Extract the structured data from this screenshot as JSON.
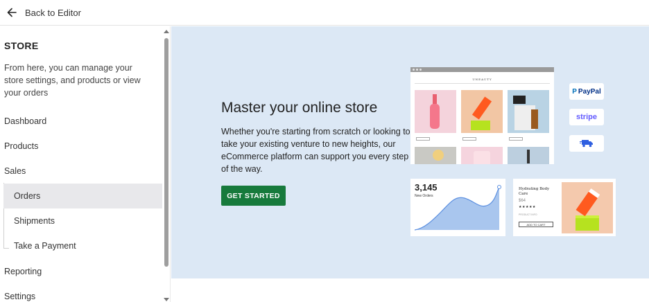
{
  "topbar": {
    "back_label": "Back to Editor"
  },
  "sidebar": {
    "title": "STORE",
    "description": "From here, you can manage your store settings, and products or view your orders",
    "items": {
      "dashboard": "Dashboard",
      "products": "Products",
      "sales": "Sales",
      "orders": "Orders",
      "shipments": "Shipments",
      "take_payment": "Take a Payment",
      "reporting": "Reporting",
      "settings": "Settings"
    }
  },
  "hero": {
    "title": "Master your online store",
    "body": "Whether you're starting from scratch or looking to take your existing venture to new heights, our eCommerce platform can support you every step of the way.",
    "cta": "GET STARTED"
  },
  "illustration": {
    "brand": "UNEAUTY",
    "payments": {
      "paypal": "PayPal",
      "stripe": "stripe"
    },
    "orders_count": "3,145",
    "orders_label": "New Orders",
    "product_name": "Hydrating Body Care",
    "product_price": "$64",
    "product_stars": "★★★★★",
    "product_info": "PRODUCT INFO",
    "add_to_cart": "ADD TO CART"
  },
  "colors": {
    "accent": "#177a3c",
    "hero_bg": "#dce8f5",
    "active_nav": "#e8e8eb",
    "chart": "#a9c6ee"
  }
}
